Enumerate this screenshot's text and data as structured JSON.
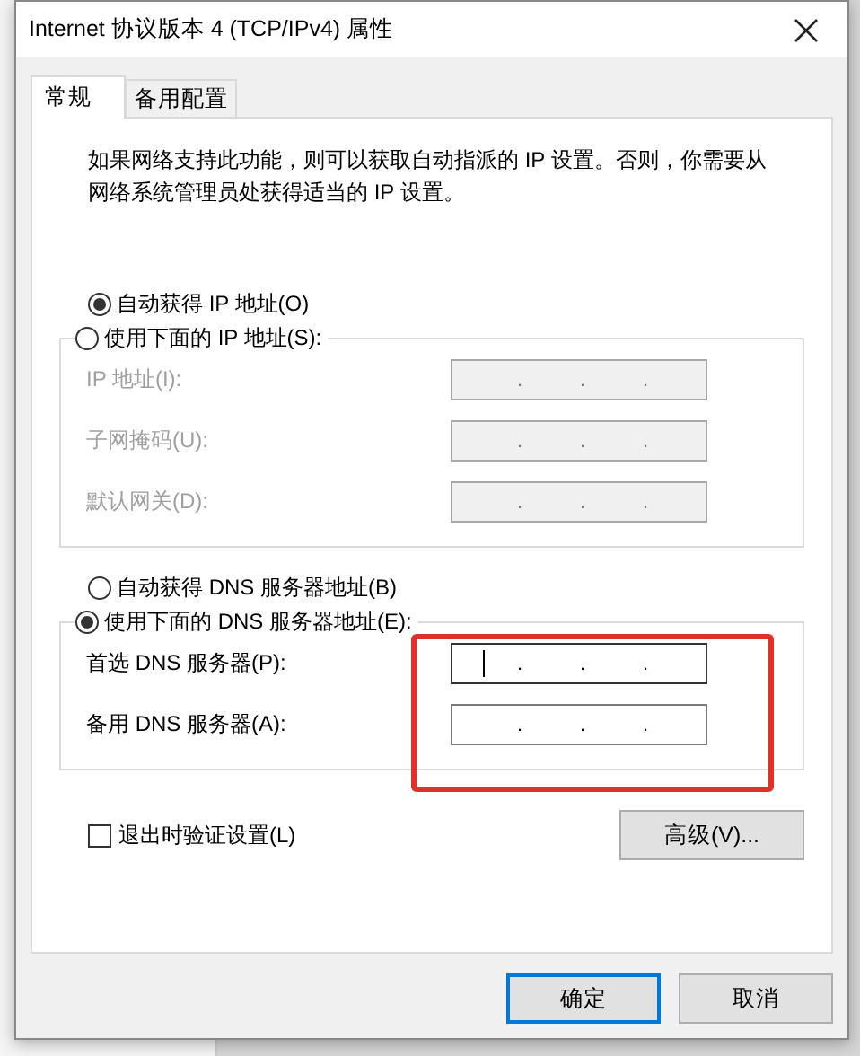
{
  "window": {
    "title": "Internet 协议版本 4 (TCP/IPv4) 属性"
  },
  "tabs": [
    {
      "label": "常规",
      "selected": true
    },
    {
      "label": "备用配置",
      "selected": false
    }
  ],
  "description": "如果网络支持此功能，则可以获取自动指派的 IP 设置。否则，你需要从网络系统管理员处获得适当的 IP 设置。",
  "ip_section": {
    "options": [
      {
        "label": "自动获得 IP 地址(O)",
        "selected": true
      },
      {
        "label": "使用下面的 IP 地址(S):",
        "selected": false
      }
    ],
    "fields": [
      {
        "label": "IP 地址(I):",
        "disabled": true,
        "focused": false,
        "separator": "."
      },
      {
        "label": "子网掩码(U):",
        "disabled": true,
        "focused": false,
        "separator": "."
      },
      {
        "label": "默认网关(D):",
        "disabled": true,
        "focused": false,
        "separator": "."
      }
    ]
  },
  "dns_section": {
    "options": [
      {
        "label": "自动获得 DNS 服务器地址(B)",
        "selected": false
      },
      {
        "label": "使用下面的 DNS 服务器地址(E):",
        "selected": true
      }
    ],
    "fields": [
      {
        "label": "首选 DNS 服务器(P):",
        "disabled": false,
        "focused": true,
        "separator": "."
      },
      {
        "label": "备用 DNS 服务器(A):",
        "disabled": false,
        "focused": false,
        "separator": "."
      }
    ]
  },
  "validate_checkbox": {
    "label": "退出时验证设置(L)",
    "checked": false
  },
  "advanced_button": "高级(V)...",
  "buttons": [
    {
      "label": "确定",
      "default": true
    },
    {
      "label": "取消",
      "default": false
    }
  ]
}
